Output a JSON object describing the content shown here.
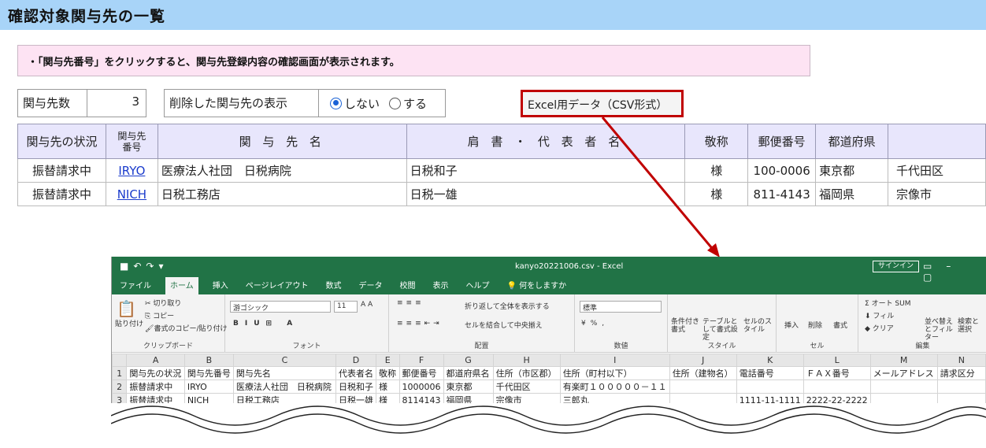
{
  "page": {
    "title": "確認対象関与先の一覧",
    "notice": "・「関与先番号」をクリックすると、関与先登録内容の確認画面が表示されます。"
  },
  "summary": {
    "count_label": "関与先数",
    "count_value": "3",
    "deleted_label": "削除した関与先の表示",
    "option_no": "しない",
    "option_yes": "する",
    "selected": "no"
  },
  "excel_button": "Excel用データ（CSV形式）",
  "table": {
    "headers": {
      "status": "関与先の状況",
      "number": "関与先番号",
      "name": "関 与 先 名",
      "rep": "肩 書 ・ 代 表 者 名",
      "honor": "敬称",
      "zip": "郵便番号",
      "pref": "都道府県"
    },
    "rows": [
      {
        "status": "振替請求中",
        "number": "IRYO",
        "name": "医療法人社団　日税病院",
        "rep": "日税和子",
        "honor": "様",
        "zip": "100-0006",
        "pref": "東京都",
        "city": "千代田区"
      },
      {
        "status": "振替請求中",
        "number": "NICH",
        "name": "日税工務店",
        "rep": "日税一雄",
        "honor": "様",
        "zip": "811-4143",
        "pref": "福岡県",
        "city": "宗像市"
      }
    ]
  },
  "excel": {
    "filename": "kanyo20221006.csv  -  Excel",
    "signin": "サインイン",
    "tabs": [
      "ファイル",
      "ホーム",
      "挿入",
      "ページレイアウト",
      "数式",
      "データ",
      "校閲",
      "表示",
      "ヘルプ",
      "何をしますか"
    ],
    "active_tab": "ホーム",
    "ribbon": {
      "clipboard": {
        "name": "クリップボード",
        "paste": "貼り付け",
        "cut": "切り取り",
        "copy": "コピー",
        "format_copy": "書式のコピー/貼り付け"
      },
      "font": {
        "name": "フォント",
        "family": "游ゴシック",
        "size": "11"
      },
      "align": {
        "name": "配置",
        "wrap": "折り返して全体を表示する",
        "merge": "セルを結合して中央揃え"
      },
      "number": {
        "name": "数値",
        "format": "標準"
      },
      "style": {
        "name": "スタイル",
        "cond": "条件付き書式",
        "table": "テーブルとして書式設定",
        "cell": "セルのスタイル"
      },
      "cells": {
        "name": "セル",
        "insert": "挿入",
        "delete": "削除",
        "format": "書式"
      },
      "edit": {
        "name": "編集",
        "autosum": "オート SUM",
        "fill": "フィル",
        "clear": "クリア",
        "sort": "並べ替えとフィルター",
        "find": "検索と選択"
      }
    },
    "columns": [
      "A",
      "B",
      "C",
      "D",
      "E",
      "F",
      "G",
      "H",
      "I",
      "J",
      "K",
      "L",
      "M",
      "N"
    ],
    "rows": [
      [
        "1",
        "関与先の状況",
        "関与先番号",
        "関与先名",
        "代表者名",
        "敬称",
        "郵便番号",
        "都道府県名",
        "住所（市区郡）",
        "住所（町村以下）",
        "住所（建物名）",
        "電話番号",
        "ＦＡＸ番号",
        "メールアドレス",
        "請求区分"
      ],
      [
        "2",
        "振替請求中",
        "IRYO",
        "医療法人社団　日税病院",
        "日税和子",
        "様",
        "1000006",
        "東京都",
        "千代田区",
        "有楽町１０００００－１１",
        "",
        "",
        "",
        "",
        ""
      ],
      [
        "3",
        "振替請求中",
        "NICH",
        "日税工務店",
        "日税一雄",
        "様",
        "8114143",
        "福岡県",
        "宗像市",
        "三郎丸",
        "",
        "1111-11-1111",
        "2222-22-2222",
        "",
        ""
      ]
    ]
  },
  "colors": {
    "title_bg": "#a8d4f8",
    "notice_bg": "#fde3f3",
    "accent_red": "#c00000",
    "excel_green": "#217346"
  }
}
